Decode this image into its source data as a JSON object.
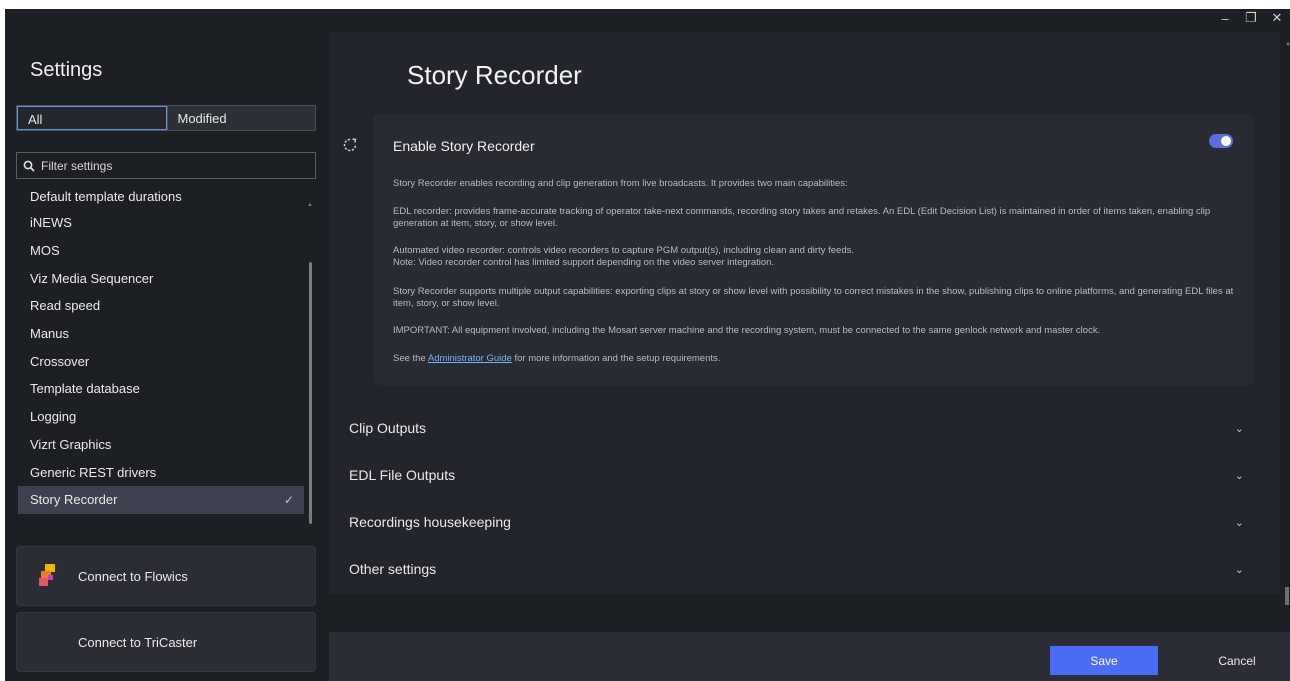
{
  "window": {
    "minimize_icon": "minimize-icon",
    "restore_icon": "restore-icon",
    "close_icon": "close-icon",
    "minimize": "–",
    "restore": "❐",
    "close": "✕"
  },
  "sidebar": {
    "title": "Settings",
    "tabs": [
      {
        "label": "All",
        "active": true
      },
      {
        "label": "Modified",
        "active": false
      }
    ],
    "filter_placeholder": "Filter settings",
    "items": [
      {
        "label": "Default template durations"
      },
      {
        "label": "iNEWS"
      },
      {
        "label": "MOS"
      },
      {
        "label": "Viz Media Sequencer"
      },
      {
        "label": "Read speed"
      },
      {
        "label": "Manus"
      },
      {
        "label": "Crossover"
      },
      {
        "label": "Template database"
      },
      {
        "label": "Logging"
      },
      {
        "label": "Vizrt Graphics"
      },
      {
        "label": "Generic REST drivers"
      },
      {
        "label": "Story Recorder",
        "selected": true
      }
    ],
    "selected_check": "✓",
    "connect_flowics": "Connect to Flowics",
    "connect_tricaster": "Connect to TriCaster"
  },
  "main": {
    "title": "Story Recorder",
    "enable": {
      "label": "Enable Story Recorder",
      "enabled": true,
      "paragraphs": [
        "Story Recorder enables recording and clip generation from live broadcasts. It provides two main capabilities:",
        "EDL recorder: provides frame-accurate tracking of operator take-next commands, recording story takes and retakes. An EDL (Edit Decision List) is maintained in order of items taken, enabling clip generation at item, story, or show level.",
        "Automated video recorder: controls video recorders to capture PGM output(s), including clean and dirty feeds.",
        "Note: Video recorder control has limited support depending on the video server integration.",
        "Story Recorder supports multiple output capabilities: exporting clips at story or show level with possibility to correct mistakes in the show, publishing clips to online platforms, and generating EDL files at item, story, or show level.",
        "IMPORTANT: All equipment involved, including the Mosart server machine and the recording system, must be connected to the same genlock network and master clock."
      ],
      "guide_prefix": "See the ",
      "guide_link": "Administrator Guide",
      "guide_suffix": " for more information and the setup requirements."
    },
    "sections": [
      {
        "label": "Clip Outputs"
      },
      {
        "label": "EDL File Outputs"
      },
      {
        "label": "Recordings housekeeping"
      },
      {
        "label": "Other settings"
      }
    ],
    "chevron": "⌄"
  },
  "footer": {
    "save": "Save",
    "cancel": "Cancel"
  },
  "colors": {
    "accent": "#4a6cf7",
    "toggle": "#5b6ee1",
    "link": "#7ab2ff"
  }
}
